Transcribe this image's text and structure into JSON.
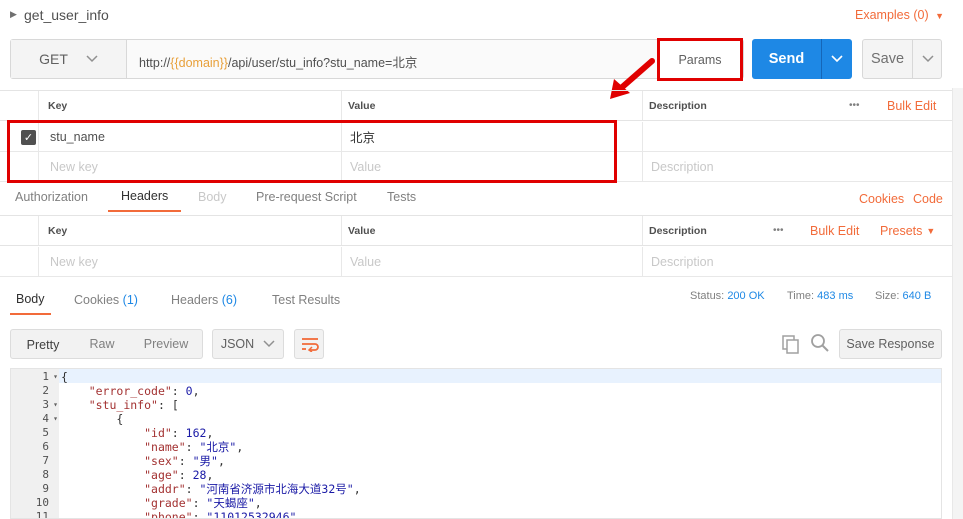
{
  "request": {
    "name": "get_user_info",
    "examples_label": "Examples (0)",
    "method": "GET",
    "url_prefix": "http://",
    "url_variable": "{{domain}}",
    "url_suffix": "/api/user/stu_info?stu_name=北京",
    "params_label": "Params",
    "send_label": "Send",
    "save_label": "Save"
  },
  "params_table": {
    "columns": [
      "Key",
      "Value",
      "Description"
    ],
    "more_label": "•••",
    "bulk_edit_label": "Bulk Edit",
    "rows": [
      {
        "key": "stu_name",
        "value": "北京",
        "checked": true
      }
    ],
    "placeholder": {
      "key": "New key",
      "value": "Value",
      "description": "Description"
    }
  },
  "request_tabs": {
    "items": [
      "Authorization",
      "Headers",
      "Body",
      "Pre-request Script",
      "Tests"
    ],
    "active": "Headers",
    "cookies_label": "Cookies",
    "code_label": "Code"
  },
  "headers_table": {
    "columns": [
      "Key",
      "Value",
      "Description"
    ],
    "more_label": "•••",
    "bulk_edit_label": "Bulk Edit",
    "presets_label": "Presets",
    "placeholder": {
      "key": "New key",
      "value": "Value",
      "description": "Description"
    }
  },
  "response_tabs": {
    "body": "Body",
    "cookies": "Cookies",
    "cookies_count": "(1)",
    "headers": "Headers",
    "headers_count": "(6)",
    "test_results": "Test Results"
  },
  "response_meta": {
    "status_label": "Status:",
    "status_value": "200 OK",
    "time_label": "Time:",
    "time_value": "483 ms",
    "size_label": "Size:",
    "size_value": "640 B"
  },
  "response_toolbar": {
    "views": [
      "Pretty",
      "Raw",
      "Preview"
    ],
    "active_view": "Pretty",
    "format": "JSON",
    "save_response_label": "Save Response"
  },
  "code_lines": [
    {
      "n": "1",
      "fold": true,
      "text": "{"
    },
    {
      "n": "2",
      "fold": false,
      "key": "\"error_code\"",
      "val": "0",
      "valtype": "n",
      "indent": 4,
      "end": ","
    },
    {
      "n": "3",
      "fold": true,
      "key": "\"stu_info\"",
      "val": "[",
      "valtype": "p",
      "indent": 4,
      "end": ""
    },
    {
      "n": "4",
      "fold": true,
      "text": "        {"
    },
    {
      "n": "5",
      "fold": false,
      "key": "\"id\"",
      "val": "162",
      "valtype": "n",
      "indent": 12,
      "end": ","
    },
    {
      "n": "6",
      "fold": false,
      "key": "\"name\"",
      "val": "\"北京\"",
      "valtype": "s",
      "indent": 12,
      "end": ","
    },
    {
      "n": "7",
      "fold": false,
      "key": "\"sex\"",
      "val": "\"男\"",
      "valtype": "s",
      "indent": 12,
      "end": ","
    },
    {
      "n": "8",
      "fold": false,
      "key": "\"age\"",
      "val": "28",
      "valtype": "n",
      "indent": 12,
      "end": ","
    },
    {
      "n": "9",
      "fold": false,
      "key": "\"addr\"",
      "val": "\"河南省济源市北海大道32号\"",
      "valtype": "s",
      "indent": 12,
      "end": ","
    },
    {
      "n": "10",
      "fold": false,
      "key": "\"grade\"",
      "val": "\"天蝎座\"",
      "valtype": "s",
      "indent": 12,
      "end": ","
    },
    {
      "n": "11",
      "fold": false,
      "key": "\"phone\"",
      "val": "\"11012532946\"",
      "valtype": "s",
      "indent": 12,
      "end": ","
    }
  ],
  "colors": {
    "accent": "#f26b3a",
    "send": "#1e88e5",
    "annotation": "#e00000"
  }
}
